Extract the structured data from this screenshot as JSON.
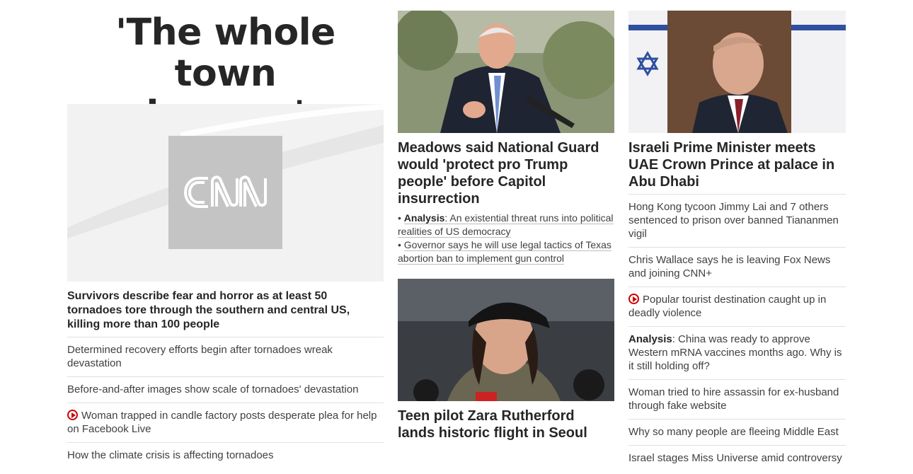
{
  "left_column": {
    "banner_line1": "'The whole town",
    "banner_line2": "is gone'",
    "hero_logo": "CNN",
    "main_headline": "Survivors describe fear and horror as at least 50 tornadoes tore through the southern and central US, killing more than 100 people",
    "items": [
      {
        "text": "Determined recovery efforts begin after tornadoes wreak devastation",
        "video": false
      },
      {
        "text": "Before-and-after images show scale of tornadoes' devastation",
        "video": false
      },
      {
        "text": "Woman trapped in candle factory posts desperate plea for help on Facebook Live",
        "video": true
      },
      {
        "text": "How the climate crisis is affecting tornadoes",
        "video": false
      }
    ]
  },
  "middle_column": {
    "story1": {
      "title": "Meadows said National Guard would 'protect pro Trump people' before Capitol insurrection",
      "sub1_prefix": "Analysis",
      "sub1_text": ": An existential threat runs into political realities of US democracy",
      "sub2_text": "Governor says he will use legal tactics of Texas abortion ban to implement gun control"
    },
    "story2": {
      "title": "Teen pilot Zara Rutherford lands historic flight in Seoul"
    }
  },
  "right_column": {
    "story": {
      "title": "Israeli Prime Minister meets UAE Crown Prince at palace in Abu Dhabi"
    },
    "items": [
      {
        "text": "Hong Kong tycoon Jimmy Lai and 7 others sentenced to prison over banned Tiananmen vigil"
      },
      {
        "text": "Chris Wallace says he is leaving Fox News and joining CNN+"
      },
      {
        "text": "Popular tourist destination caught up in deadly violence"
      },
      {
        "prefix": "Analysis",
        "text": ": China was ready to approve Western mRNA vaccines months ago. Why is it still holding off?"
      },
      {
        "text": "Woman tried to hire assassin for ex-husband through fake website"
      },
      {
        "text": "Why so many people are fleeing Middle East"
      },
      {
        "text": "Israel stages Miss Universe amid controversy"
      }
    ]
  },
  "colors": {
    "text": "#262626",
    "secondary_text": "#404040",
    "divider": "#e0e0e0",
    "video_icon": "#cc0000"
  },
  "icons": [
    "play-video-icon",
    "cnn-logo"
  ]
}
